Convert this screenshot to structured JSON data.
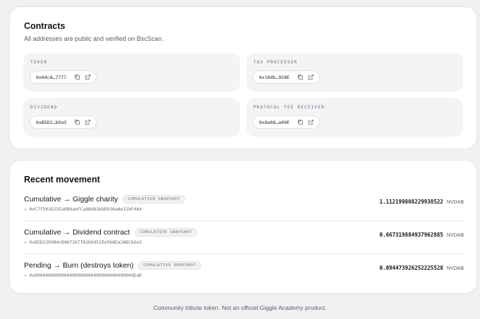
{
  "contracts": {
    "title": "Contracts",
    "subtitle": "All addresses are public and verified on BscScan.",
    "items": [
      {
        "label": "TOKEN",
        "address": "0x84cA…7777"
      },
      {
        "label": "TAX PROCESSOR",
        "address": "0x10db…928E"
      },
      {
        "label": "DIVIDEND",
        "address": "0xB5D2…b9a3"
      },
      {
        "label": "PROTOCOL FEE RECEIVER",
        "address": "0x8a08…a00E"
      }
    ]
  },
  "movement": {
    "title": "Recent movement",
    "rows": [
      {
        "title": "Cumulative → Giggle charity",
        "badge": "CUMULATIVE SNAPSHOT",
        "destination": "→ 0xC7f501D25Ea088aeFCa8B4b3ebD936aAe12bF4A4",
        "amount": "1.112199808229938522",
        "unit": "NVDAB"
      },
      {
        "title": "Cumulative → Dividend contract",
        "badge": "CUMULATIVE SNAPSHOT",
        "destination": "→ 0xB5D22E0B4cD467267f82b0d51Ee9b8Ea2ABCb9a3",
        "amount": "0.667319884937962885",
        "unit": "NVDAB"
      },
      {
        "title": "Pending → Burn (destroys token)",
        "badge": "CUMULATIVE SNAPSHOT",
        "destination": "→ 0x000000000000000000000000000000000000dEaD",
        "amount": "0.094473926252225528",
        "unit": "NVDAB"
      }
    ]
  },
  "footer": {
    "text": "Community tribute token. Not an official Giggle Academy product."
  }
}
